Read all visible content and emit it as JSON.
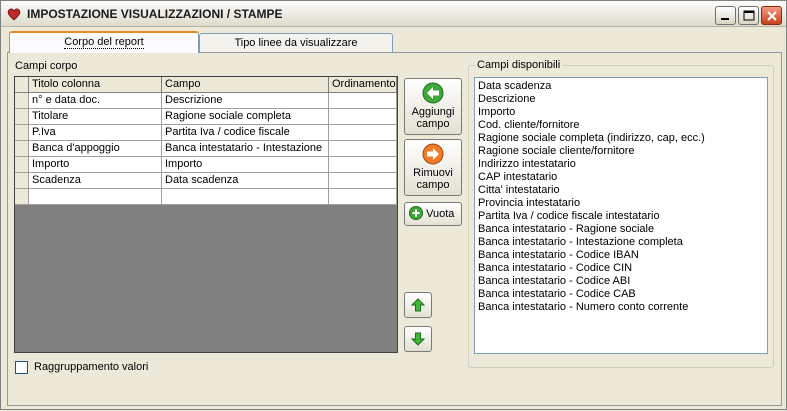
{
  "window": {
    "title": "IMPOSTAZIONE VISUALIZZAZIONI / STAMPE",
    "accent": "#e68b2c"
  },
  "tabs": [
    {
      "label": "Corpo del report",
      "active": true
    },
    {
      "label": "Tipo linee da visualizzare",
      "active": false
    }
  ],
  "corpo": {
    "section_label": "Campi corpo",
    "columns": [
      "Titolo colonna",
      "Campo",
      "Ordinamento"
    ],
    "rows": [
      [
        "n° e data doc.",
        "Descrizione",
        ""
      ],
      [
        "Titolare",
        "Ragione sociale completa",
        ""
      ],
      [
        "P.Iva",
        "Partita Iva / codice fiscale",
        ""
      ],
      [
        "Banca d'appoggio",
        "Banca intestatario - Intestazione",
        ""
      ],
      [
        "Importo",
        "Importo",
        ""
      ],
      [
        "Scadenza",
        "Data scadenza",
        ""
      ],
      [
        "",
        "",
        ""
      ]
    ]
  },
  "buttons": {
    "add_line1": "Aggiungi",
    "add_line2": "campo",
    "remove_line1": "Rimuovi",
    "remove_line2": "campo",
    "empty": "Vuota"
  },
  "disponibili": {
    "legend": "Campi disponibili",
    "items": [
      "Data scadenza",
      "Descrizione",
      "Importo",
      "Cod. cliente/fornitore",
      "Ragione sociale completa (indirizzo, cap, ecc.)",
      "Ragione sociale cliente/fornitore",
      "Indirizzo intestatario",
      "CAP intestatario",
      "Citta' intestatario",
      "Provincia intestatario",
      "Partita Iva / codice fiscale intestatario",
      "Banca intestatario - Ragione sociale",
      "Banca intestatario - Intestazione completa",
      "Banca intestatario - Codice IBAN",
      "Banca intestatario - Codice CIN",
      "Banca intestatario - Codice ABI",
      "Banca intestatario - Codice CAB",
      "Banca intestatario - Numero conto corrente"
    ]
  },
  "grouping": {
    "label": "Raggruppamento valori",
    "checked": false
  }
}
